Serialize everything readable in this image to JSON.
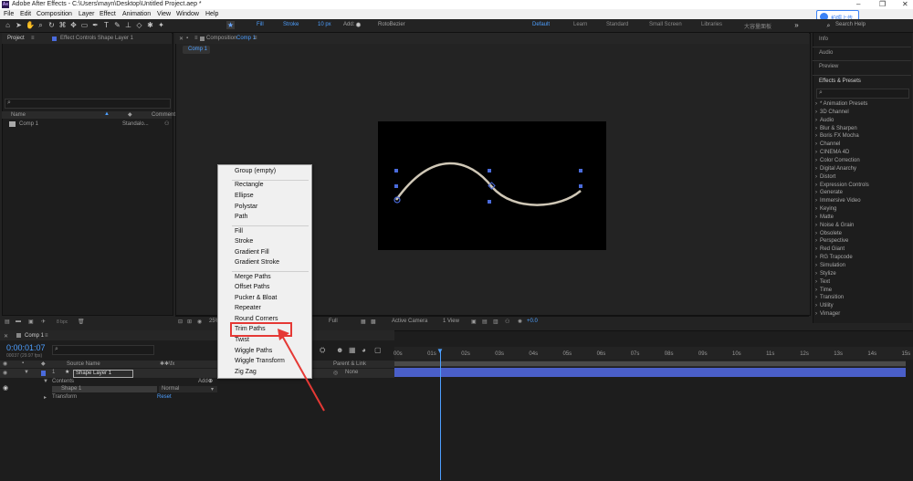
{
  "window": {
    "title": "Adobe After Effects - C:\\Users\\mayn\\Desktop\\Untitled Project.aep *",
    "logo": "Ae"
  },
  "menubar": [
    "File",
    "Edit",
    "Composition",
    "Layer",
    "Effect",
    "Animation",
    "View",
    "Window",
    "Help"
  ],
  "toolbar": {
    "fill_label": "Fill",
    "stroke_label": "Stroke",
    "stroke_width": "10 px",
    "add_label": "Add:",
    "rotobezier": "RotoBezier"
  },
  "workspaces": [
    "Default",
    "Learn",
    "Standard",
    "Small Screen",
    "Libraries",
    "大容量面板"
  ],
  "search_help": "Search Help",
  "upload_badge": "拍照上传",
  "project_panel": {
    "tab": "Project",
    "effect_controls": "Effect Controls Shape Layer 1",
    "col_name": "Name",
    "col_comment": "Comment",
    "item_name": "Comp 1",
    "item_type": "Standalo...",
    "bpc": "8 bpc"
  },
  "comp_panel": {
    "tab": "Composition",
    "comp_name": "Comp 1",
    "crumb": "Comp 1",
    "zoom": "25%",
    "resolution": "Full",
    "camera": "Active Camera",
    "views": "1 View",
    "offset": "+0.0"
  },
  "right_panel": {
    "info": "Info",
    "audio": "Audio",
    "preview": "Preview",
    "effects_presets": "Effects & Presets",
    "items": [
      "* Animation Presets",
      "3D Channel",
      "Audio",
      "Blur & Sharpen",
      "Boris FX Mocha",
      "Channel",
      "CINEMA 4D",
      "Color Correction",
      "Digital Anarchy",
      "Distort",
      "Expression Controls",
      "Generate",
      "Immersive Video",
      "Keying",
      "Matte",
      "Noise & Grain",
      "Obsolete",
      "Perspective",
      "Red Giant",
      "RG Trapcode",
      "Simulation",
      "Stylize",
      "Text",
      "Time",
      "Transition",
      "Utility",
      "Vimager"
    ]
  },
  "timeline": {
    "tab": "Comp 1",
    "timecode": "0:00:01:07",
    "fps": "00037 (29.97 fps)",
    "col_source": "Source Name",
    "col_parent": "Parent & Link",
    "layer_num": "1",
    "layer_name": "Shape Layer 1",
    "contents": "Contents",
    "shape": "Shape 1",
    "transform": "Transform",
    "reset": "Reset",
    "blend": "Normal",
    "parent": "None",
    "add": "Add",
    "ruler": [
      "00s",
      "01s",
      "02s",
      "03s",
      "04s",
      "05s",
      "06s",
      "07s",
      "08s",
      "09s",
      "10s",
      "11s",
      "12s",
      "13s",
      "14s",
      "15s"
    ]
  },
  "context_menu": {
    "group1": [
      "Group (empty)"
    ],
    "group2": [
      "Rectangle",
      "Ellipse",
      "Polystar",
      "Path"
    ],
    "group3": [
      "Fill",
      "Stroke",
      "Gradient Fill",
      "Gradient Stroke"
    ],
    "group4": [
      "Merge Paths",
      "Offset Paths",
      "Pucker & Bloat",
      "Repeater",
      "Round Corners",
      "Trim Paths",
      "Twist",
      "Wiggle Paths",
      "Wiggle Transform",
      "Zig Zag"
    ],
    "highlighted": "Trim Paths"
  },
  "colors": {
    "accent": "#2d8ceb",
    "highlight_box": "#e53935",
    "timecode": "#4d9fff",
    "layer_bar": "#4a5fc9",
    "stroke_swatch": "#f1d100"
  }
}
